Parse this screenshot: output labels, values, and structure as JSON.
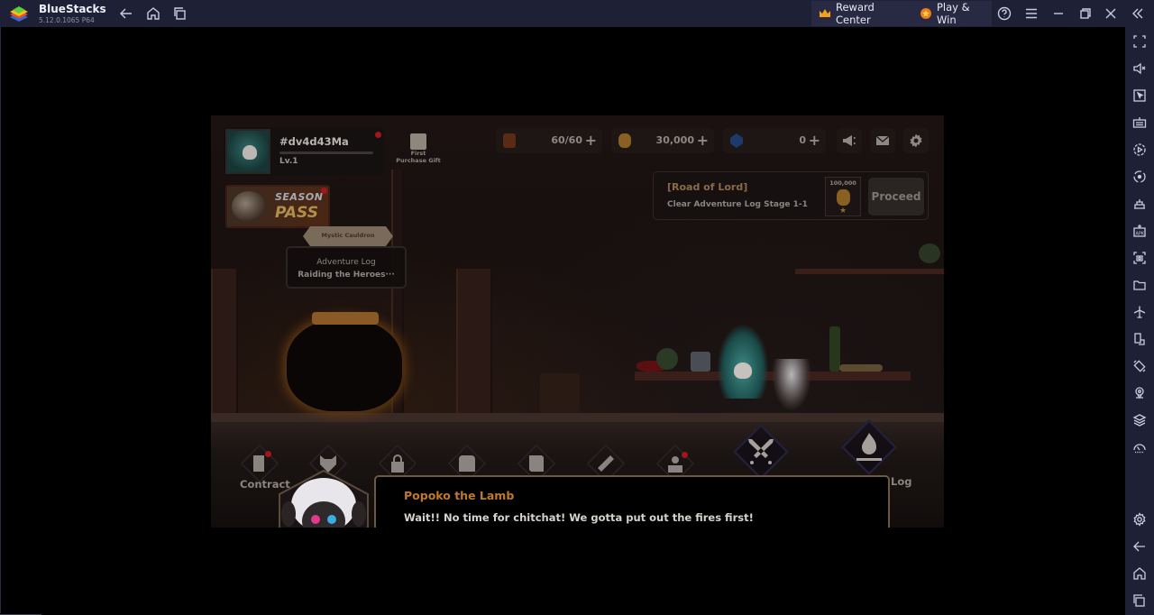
{
  "titlebar": {
    "app_name": "BlueStacks",
    "version": "5.12.0.1065  P64",
    "reward_center": "Reward Center",
    "play_win": "Play & Win"
  },
  "sidebar": {
    "items": [
      "fullscreen",
      "mute",
      "pointer",
      "keyboard",
      "record",
      "rotate-sync",
      "macro",
      "install-apk",
      "screenshot",
      "folder",
      "airplane",
      "multi-instance",
      "rotate",
      "location",
      "layers",
      "performance",
      "settings",
      "back",
      "home",
      "recents"
    ]
  },
  "game": {
    "player": {
      "name": "#dv4d43Ma",
      "level": "Lv.1",
      "xp_fraction": 0
    },
    "first_gift": {
      "line1": "First",
      "line2": "Purchase Gift"
    },
    "resources": [
      {
        "icon": "lantern",
        "value": "60/60"
      },
      {
        "icon": "gold-coins",
        "value": "30,000"
      },
      {
        "icon": "blue-gem",
        "value": "0"
      }
    ],
    "quest": {
      "title": "[Road of Lord]",
      "description": "Clear Adventure Log Stage 1-1",
      "reward_amount": "100,000",
      "proceed_label": "Proceed"
    },
    "season_pass": {
      "line1": "SEASON",
      "line2": "PASS"
    },
    "cauldron": {
      "banner": "Mystic Cauldron",
      "line1": "Adventure Log",
      "line2": "Raiding the Heroes···"
    },
    "nav": {
      "contract_label": "Contract",
      "log_label": "Log"
    },
    "dialog": {
      "speaker": "Popoko the Lamb",
      "text": "Wait!! No time for chitchat! We gotta put out the fires first!"
    }
  },
  "colors": {
    "chrome": "#1e2035",
    "speaker": "#c0782a",
    "dialog_border": "#6a5a42"
  }
}
